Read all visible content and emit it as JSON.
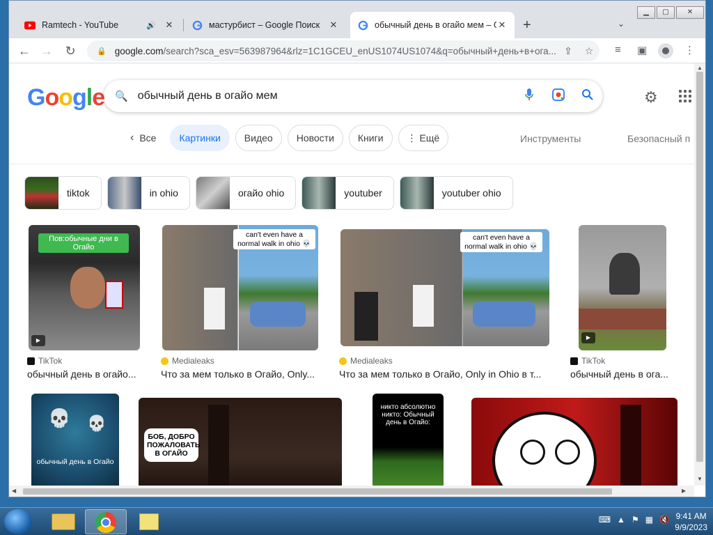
{
  "browser": {
    "tabs": [
      {
        "title": "Ramtech - YouTube",
        "favicon": "youtube-icon",
        "audio": true
      },
      {
        "title": "мастурбист – Google Поиск",
        "favicon": "google-icon"
      },
      {
        "title": "обычный день в огайо мем – G",
        "favicon": "google-icon",
        "active": true
      }
    ],
    "url_host": "google.com",
    "url_path": "/search?sca_esv=563987964&rlz=1C1GCEU_enUS1074US1074&q=обычный+день+в+ога..."
  },
  "google": {
    "logo": "Google",
    "query": "обычный день в огайо мем",
    "chips": {
      "all": "Все",
      "images": "Картинки",
      "video": "Видео",
      "news": "Новости",
      "books": "Книги",
      "more": "Ещё"
    },
    "tools": "Инструменты",
    "safe_search": "Безопасный п",
    "related": [
      {
        "label": "tiktok"
      },
      {
        "label": "in ohio"
      },
      {
        "label": "огайо ohio"
      },
      {
        "label": "youtuber"
      },
      {
        "label": "youtuber ohio"
      }
    ],
    "results": [
      {
        "source": "TikTok",
        "caption": "обычный день в огайо...",
        "overlay": "Пов:обычные дни в Огайо"
      },
      {
        "source": "Medialeaks",
        "caption": "Что за мем только в Огайо, Only...",
        "overlay": "can't even have a normal walk in ohio 💀"
      },
      {
        "source": "Medialeaks",
        "caption": "Что за мем только в Огайо, Only in Ohio в т...",
        "overlay": "can't even have a normal walk in ohio 💀"
      },
      {
        "source": "TikTok",
        "caption": "обычный день в ога..."
      }
    ],
    "row2": [
      {
        "overlay": "обычный день в Огайо"
      },
      {
        "overlay": "БОБ, ДОБРО ПОЖАЛОВАТЬ В ОГАЙО"
      },
      {
        "overlay": "никто абсолютно никто: Обычный день в Огайо:"
      },
      {}
    ]
  },
  "taskbar": {
    "time": "9:41 AM",
    "date": "9/9/2023"
  }
}
